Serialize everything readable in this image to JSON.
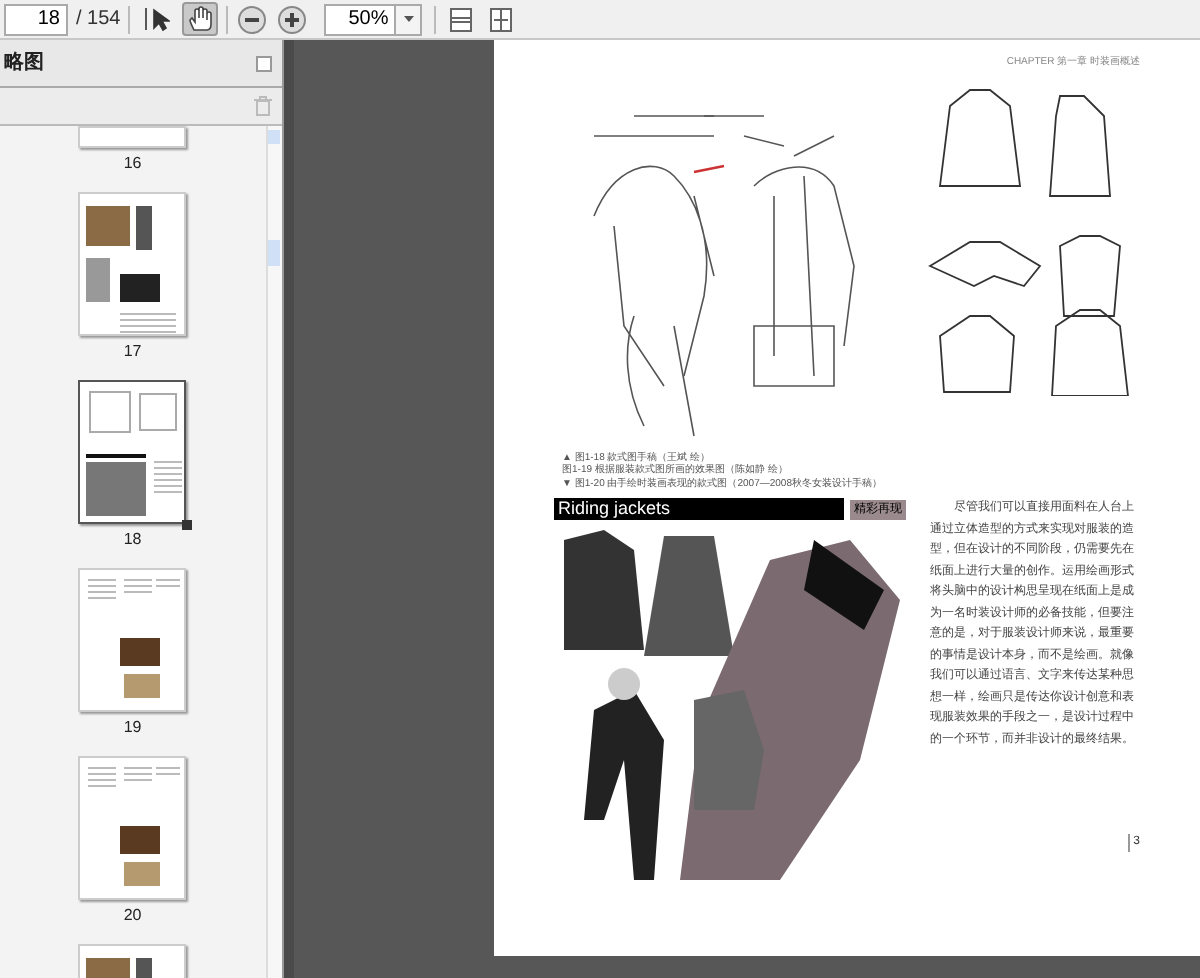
{
  "toolbar": {
    "page_field": "18",
    "page_total": "/ 154",
    "tools": [
      {
        "kind": "select",
        "selected": false
      },
      {
        "kind": "hand",
        "selected": true
      }
    ],
    "zoom": "50%"
  },
  "sidebar": {
    "title": "略图",
    "thumbnails": [
      {
        "label": "16",
        "selected": false,
        "kind": "partial"
      },
      {
        "label": "17",
        "selected": false,
        "kind": "photos"
      },
      {
        "label": "18",
        "selected": true,
        "kind": "sketches"
      },
      {
        "label": "19",
        "selected": false,
        "kind": "text"
      },
      {
        "label": "20",
        "selected": false,
        "kind": "text"
      },
      {
        "selected": false,
        "kind": "photos"
      }
    ]
  },
  "page": {
    "header": "CHAPTER 第一章 时装画概述",
    "captions": [
      "▲ 图1-18 款式图手稿（王斌 绘）",
      "图1-19 根据服装款式图所画的效果图（陈如静 绘）",
      "▼ 图1-20 由手绘时装画表现的款式图（2007—2008秋冬女装设计手稿）"
    ],
    "section_title": "Riding jackets",
    "badge": "精彩再现",
    "body": "尽管我们可以直接用面料在人台上通过立体造型的方式来实现对服装的造型，但在设计的不同阶段，仍需要先在纸面上进行大量的创作。运用绘画形式将头脑中的设计构思呈现在纸面上是成为一名时装设计师的必备技能，但要注意的是，对于服装设计师来说，最重要的事情是设计本身，而不是绘画。就像我们可以通过语言、文字来传达某种思想一样，绘画只是传达你设计创意和表现服装效果的手段之一，是设计过程中的一个环节，而并非设计的最终结果。",
    "page_number": "3"
  }
}
